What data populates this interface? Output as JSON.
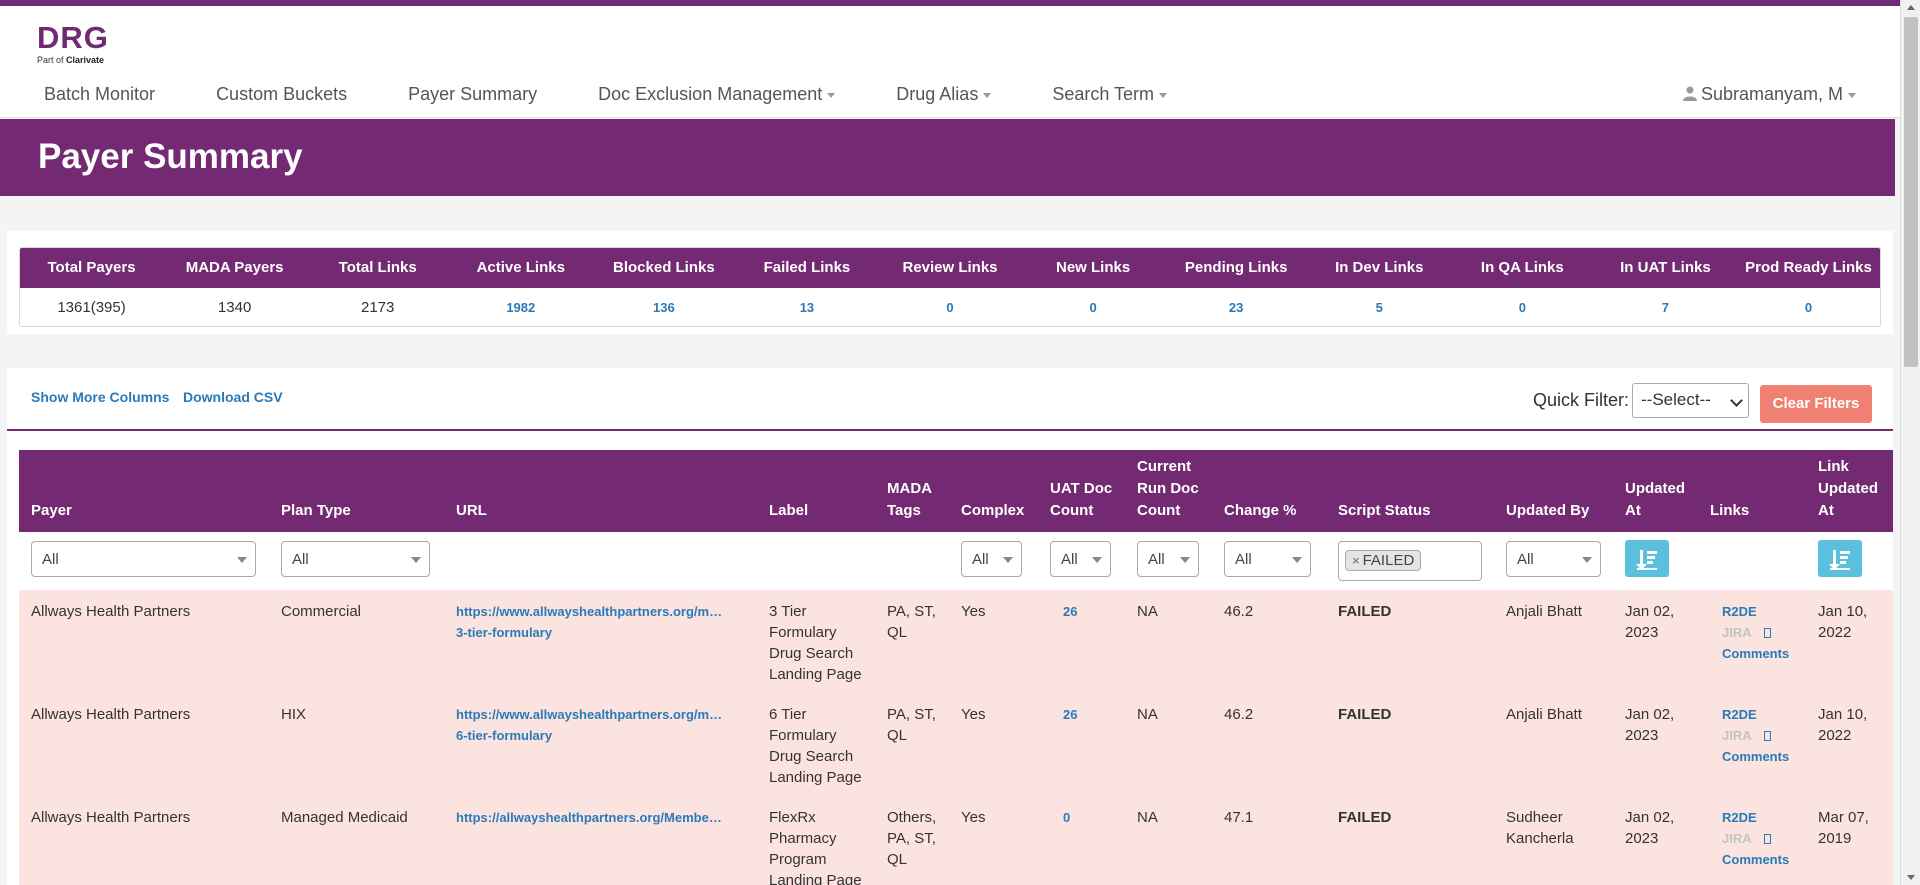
{
  "logo": {
    "text": "DRG",
    "sub_prefix": "Part of ",
    "sub_brand": "Clarivate"
  },
  "nav": {
    "items": [
      {
        "label": "Batch Monitor",
        "dropdown": false
      },
      {
        "label": "Custom Buckets",
        "dropdown": false
      },
      {
        "label": "Payer Summary",
        "dropdown": false
      },
      {
        "label": "Doc Exclusion Management",
        "dropdown": true
      },
      {
        "label": "Drug Alias",
        "dropdown": true
      },
      {
        "label": "Search Term",
        "dropdown": true
      }
    ],
    "user": "Subramanyam, M"
  },
  "page_title": "Payer Summary",
  "summary": {
    "headers": [
      "Total Payers",
      "MADA Payers",
      "Total Links",
      "Active Links",
      "Blocked Links",
      "Failed Links",
      "Review Links",
      "New Links",
      "Pending Links",
      "In Dev Links",
      "In QA Links",
      "In UAT Links",
      "Prod Ready Links"
    ],
    "values": [
      "1361(395)",
      "1340",
      "2173",
      "1982",
      "136",
      "13",
      "0",
      "0",
      "23",
      "5",
      "0",
      "7",
      "0"
    ]
  },
  "toolbar": {
    "show_more": "Show More Columns",
    "download_csv": "Download CSV",
    "quick_filter_label": "Quick Filter:",
    "quick_filter_value": "--Select--",
    "clear_filters": "Clear Filters"
  },
  "grid": {
    "headers": {
      "payer": "Payer",
      "plan_type": "Plan Type",
      "url": "URL",
      "label": "Label",
      "mada_tags": [
        "MADA",
        "Tags"
      ],
      "complex": "Complex",
      "uat_doc_count": [
        "UAT Doc",
        "Count"
      ],
      "current_run_doc_count": [
        "Current",
        "Run Doc",
        "Count"
      ],
      "change_pct": "Change %",
      "script_status": "Script Status",
      "updated_by": "Updated By",
      "updated_at": [
        "Updated",
        "At"
      ],
      "links": "Links",
      "link_updated_at": [
        "Link",
        "Updated",
        "At"
      ]
    },
    "filters": {
      "payer": "All",
      "plan_type": "All",
      "complex": "All",
      "uat_doc_count": "All",
      "current_run_doc_count": "All",
      "change_pct": "All",
      "script_status_tag": "FAILED",
      "updated_by": "All"
    },
    "rows": [
      {
        "payer": "Allways Health Partners",
        "plan_type": "Commercial",
        "url": [
          "https://www.allwayshealthpartners.org/m…",
          "3-tier-formulary"
        ],
        "label": [
          "3 Tier",
          "Formulary",
          "Drug Search",
          "Landing Page"
        ],
        "mada_tags": [
          "PA, ST,",
          "QL"
        ],
        "complex": "Yes",
        "uat_doc_count": "26",
        "current_run_doc_count": "NA",
        "change_pct": "46.2",
        "script_status": "FAILED",
        "updated_by": [
          "Anjali Bhatt"
        ],
        "updated_at": [
          "Jan 02,",
          "2023"
        ],
        "links": {
          "r2de": "R2DE",
          "jira": "JIRA",
          "comments": "Comments"
        },
        "link_updated_at": [
          "Jan 10,",
          "2022"
        ]
      },
      {
        "payer": "Allways Health Partners",
        "plan_type": "HIX",
        "url": [
          "https://www.allwayshealthpartners.org/m…",
          "6-tier-formulary"
        ],
        "label": [
          "6 Tier",
          "Formulary",
          "Drug Search",
          "Landing Page"
        ],
        "mada_tags": [
          "PA, ST,",
          "QL"
        ],
        "complex": "Yes",
        "uat_doc_count": "26",
        "current_run_doc_count": "NA",
        "change_pct": "46.2",
        "script_status": "FAILED",
        "updated_by": [
          "Anjali Bhatt"
        ],
        "updated_at": [
          "Jan 02,",
          "2023"
        ],
        "links": {
          "r2de": "R2DE",
          "jira": "JIRA",
          "comments": "Comments"
        },
        "link_updated_at": [
          "Jan 10,",
          "2022"
        ]
      },
      {
        "payer": "Allways Health Partners",
        "plan_type": "Managed Medicaid",
        "url": [
          "https://allwayshealthpartners.org/Membe…"
        ],
        "label": [
          "FlexRx",
          "Pharmacy",
          "Program",
          "Landing Page"
        ],
        "mada_tags": [
          "Others,",
          "PA, ST,",
          "QL"
        ],
        "complex": "Yes",
        "uat_doc_count": "0",
        "current_run_doc_count": "NA",
        "change_pct": "47.1",
        "script_status": "FAILED",
        "updated_by": [
          "Sudheer",
          "Kancherla"
        ],
        "updated_at": [
          "Jan 02,",
          "2023"
        ],
        "links": {
          "r2de": "R2DE",
          "jira": "JIRA",
          "comments": "Comments"
        },
        "link_updated_at": [
          "Mar 07,",
          "2019"
        ]
      }
    ]
  },
  "colors": {
    "brand_purple": "#742a72",
    "link_blue": "#2a7ab9",
    "row_failed_bg": "#fbe4e0",
    "clear_btn": "#ef8072",
    "sort_btn": "#5bc0de"
  }
}
